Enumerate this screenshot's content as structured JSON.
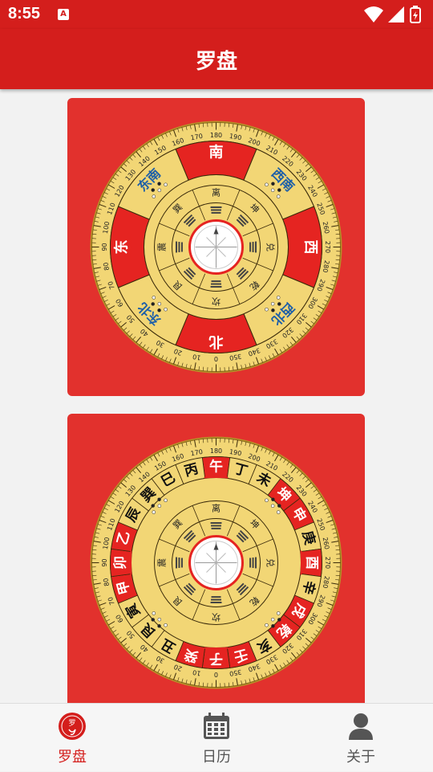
{
  "status_bar": {
    "time": "8:55",
    "notification_badge": "A"
  },
  "app_bar": {
    "title": "罗盘"
  },
  "compass1": {
    "dirs": [
      "南",
      "西南",
      "西",
      "西北",
      "北",
      "东北",
      "东",
      "东南"
    ],
    "trigrams": [
      "离",
      "坤",
      "兑",
      "乾",
      "坎",
      "艮",
      "震",
      "巽"
    ]
  },
  "compass2": {
    "mountains": [
      "午",
      "丁",
      "未",
      "坤",
      "申",
      "庚",
      "酉",
      "辛",
      "戌",
      "乾",
      "亥",
      "壬",
      "子",
      "癸",
      "丑",
      "艮",
      "寅",
      "甲",
      "卯",
      "乙",
      "辰",
      "巽",
      "巳",
      "丙"
    ],
    "trigrams": [
      "离",
      "坤",
      "兑",
      "乾",
      "坎",
      "艮",
      "震",
      "巽"
    ]
  },
  "degree_labels": [
    "0",
    "10",
    "20",
    "30",
    "40",
    "50",
    "60",
    "70",
    "80",
    "90",
    "100",
    "110",
    "120",
    "130",
    "140",
    "150",
    "160",
    "170",
    "180",
    "190",
    "200",
    "210",
    "220",
    "230",
    "240",
    "250",
    "260",
    "270",
    "280",
    "290",
    "300",
    "310",
    "320",
    "330",
    "340",
    "350"
  ],
  "bottom_nav": [
    {
      "label": "罗盘",
      "icon": "compass-logo-icon",
      "active": true
    },
    {
      "label": "日历",
      "icon": "calendar-icon",
      "active": false
    },
    {
      "label": "关于",
      "icon": "person-icon",
      "active": false
    }
  ],
  "colors": {
    "primary": "#d41e1c",
    "card": "#e2312d",
    "gold": "#f2d675",
    "red_seg": "#e52421",
    "blue_text": "#1d5fa8"
  }
}
